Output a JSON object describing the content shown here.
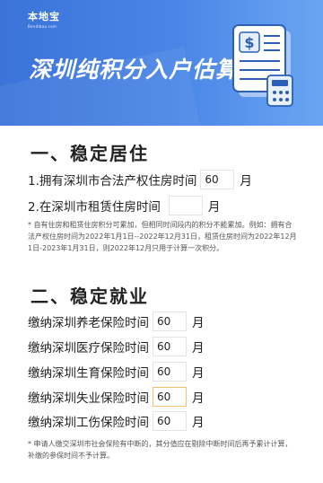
{
  "header": {
    "logo_cn": "本地宝",
    "logo_en": "Bendibao.com",
    "title": "深圳纯积分入户估算"
  },
  "section1": {
    "heading": "一、稳定居住",
    "q1_label": "1.拥有深圳市合法产权住房时间",
    "q1_value": "60",
    "q1_unit": "月",
    "q2_label": "2.在深圳市租赁住房时间",
    "q2_value": "",
    "q2_unit": "月",
    "note": "* 自有住房和租赁住房积分可累加，但相同时间段内的积分不能累加。例如：拥有合法产权住房时间为2022年1月1日--2022年12月31日，租赁住房时间为2022年12月1日-2023年1月31日，则2022年12月只用于计算一次积分。"
  },
  "section2": {
    "heading": "二、稳定就业",
    "items": [
      {
        "label": "缴纳深圳养老保险时间",
        "value": "60",
        "unit": "月"
      },
      {
        "label": "缴纳深圳医疗保险时间",
        "value": "60",
        "unit": "月"
      },
      {
        "label": "缴纳深圳生育保险时间",
        "value": "60",
        "unit": "月"
      },
      {
        "label": "缴纳深圳失业保险时间",
        "value": "60",
        "unit": "月"
      },
      {
        "label": "缴纳深圳工伤保险时间",
        "value": "60",
        "unit": "月"
      }
    ],
    "note": "* 申请人缴交深圳市社会保险有中断的，其分值应在剔除中断时间后再予累计计算，补缴的参保时间不予计算。"
  },
  "colors": {
    "banner_start": "#3b73d9",
    "banner_end": "#6aa5f2",
    "active_border": "#f0c070"
  },
  "icons": {
    "banner_illustration": "document-dollar-icon"
  }
}
